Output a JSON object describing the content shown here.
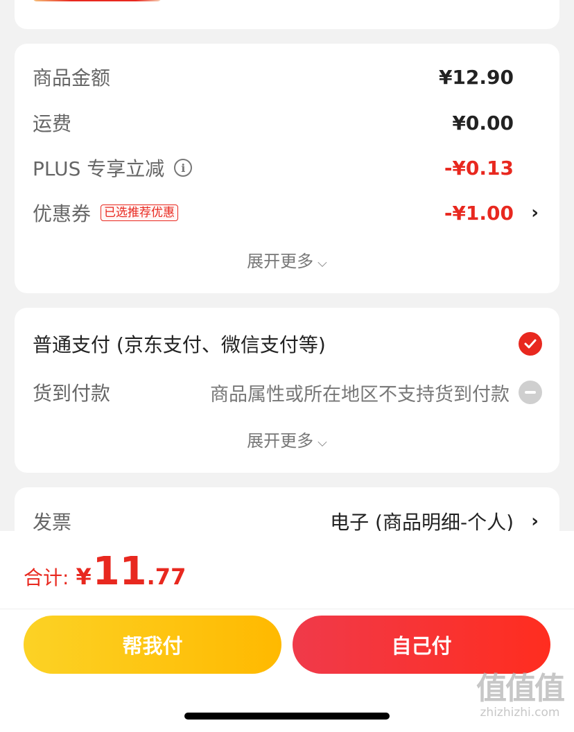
{
  "amount": {
    "rows": [
      {
        "label": "商品金额",
        "value": "¥12.90"
      },
      {
        "label": "运费",
        "value": "¥0.00"
      },
      {
        "label": "PLUS 专享立减",
        "value": "-¥0.13"
      },
      {
        "label": "优惠券",
        "tag": "已选推荐优惠",
        "value": "-¥1.00"
      }
    ],
    "expand": "展开更多"
  },
  "payment": {
    "options": [
      {
        "label": "普通支付 (京东支付、微信支付等)",
        "selected": true
      },
      {
        "label": "货到付款",
        "note": "商品属性或所在地区不支持货到付款",
        "disabled": true
      }
    ],
    "expand": "展开更多"
  },
  "invoice": {
    "label": "发票",
    "value": "电子 (商品明细-个人)"
  },
  "total": {
    "label": "合计:",
    "currency": "¥",
    "integer": "11",
    "decimal": ".77"
  },
  "buttons": {
    "help_pay": "帮我付",
    "self_pay": "自己付"
  },
  "watermark": {
    "glyphs": "值值值",
    "url": "zhizhizhi.com"
  },
  "colors": {
    "accent_red": "#e8281f",
    "yellow": "#ffc300",
    "background": "#f2f2f2"
  },
  "icons": {
    "info": "info-icon",
    "chevron": "chevron-right-icon",
    "check": "check-circle-icon",
    "disabled": "minus-circle-icon",
    "expand": "chevron-down-icon"
  }
}
